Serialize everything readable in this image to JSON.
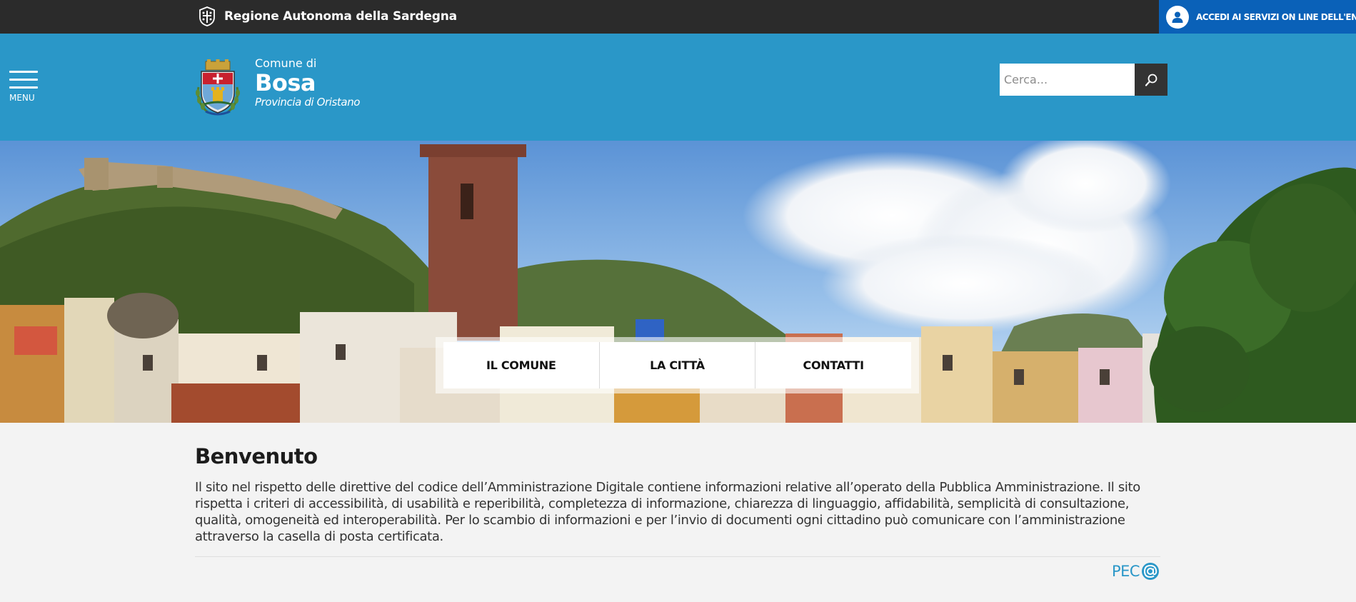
{
  "topbar": {
    "region_name": "Regione Autonoma della Sardegna",
    "login_label": "ACCEDI AI SERVIZI ON LINE DELL'ENTE"
  },
  "header": {
    "menu_label": "MENU",
    "brand_prefix": "Comune di",
    "brand_name": "Bosa",
    "brand_province": "Provincia di Oristano",
    "search_placeholder": "Cerca..."
  },
  "quicknav": {
    "items": [
      {
        "label": "IL COMUNE"
      },
      {
        "label": "LA CITTÀ"
      },
      {
        "label": "CONTATTI"
      }
    ]
  },
  "content": {
    "title": "Benvenuto",
    "text": "Il sito nel rispetto delle direttive del codice dell’Amministrazione Digitale contiene informazioni relative all’operato della Pubblica Amministrazione. Il sito rispetta i criteri di accessibilità, di usabilità e reperibilità, completezza di informazione, chiarezza di linguaggio, affidabilità, semplicità di consultazione, qualità, omogeneità ed interoperabilità. Per lo scambio di informazioni e per l’invio di documenti ogni cittadino può comunicare con l’amministrazione attraverso la casella di posta certificata.",
    "pec_label": "PEC"
  },
  "icons": {
    "region": "region-crest-icon",
    "login": "user-icon",
    "menu": "hamburger-icon",
    "search": "search-icon",
    "pec": "at-sign-icon"
  },
  "colors": {
    "topbar": "#2b2b2b",
    "header": "#2a97c8",
    "login": "#0a61b8",
    "pec": "#2a97c8"
  }
}
